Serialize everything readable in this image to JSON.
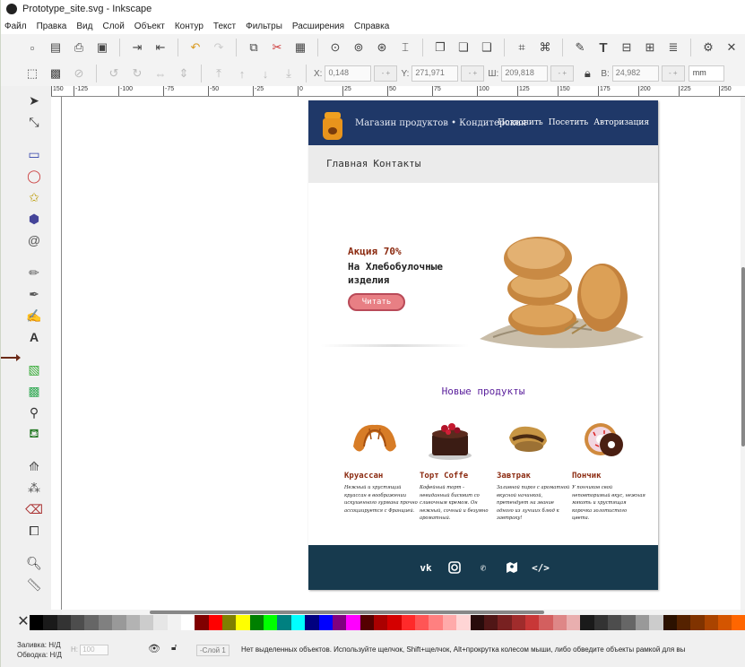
{
  "window": {
    "title": "Prototype_site.svg - Inkscape"
  },
  "menu": [
    "Файл",
    "Правка",
    "Вид",
    "Слой",
    "Объект",
    "Контур",
    "Текст",
    "Фильтры",
    "Расширения",
    "Справка"
  ],
  "toolbar_icons": [
    "new-doc-icon",
    "open-icon",
    "print-icon",
    "import-icon",
    "export-icon",
    "undo-icon",
    "redo-icon",
    "copy-icon",
    "cut-icon",
    "paste-icon",
    "zoom-selection-icon",
    "zoom-drawing-icon",
    "zoom-page-icon",
    "duplicate-icon",
    "clone-icon",
    "unlink-icon",
    "group-icon",
    "ungroup-icon",
    "fill-stroke-icon",
    "text-format-icon",
    "xml-editor-icon",
    "align-icon",
    "preferences-icon"
  ],
  "coords": {
    "x_label": "X:",
    "x_value": "0,148",
    "y_label": "Y:",
    "y_value": "271,971",
    "w_label": "Ш:",
    "w_value": "209,818",
    "h_label": "В:",
    "h_value": "24,982",
    "unit": "mm"
  },
  "ruler_ticks": [
    "150",
    "-125",
    "-100",
    "-75",
    "-50",
    "-25",
    "0",
    "25",
    "50",
    "75",
    "100",
    "125",
    "150",
    "175",
    "200",
    "225",
    "250"
  ],
  "site": {
    "shop_name": "Магазин продуктов • Кондитерская",
    "top_nav": [
      "Позвонить",
      "Посетить",
      "Авторизация"
    ],
    "sub_nav": [
      "Главная",
      "Контакты"
    ],
    "promo_title": "Акция 70%",
    "promo_line1": "На Хлебобулочные",
    "promo_line2": "изделия",
    "read_button": "Читать",
    "new_products_title": "Новые продукты",
    "products": [
      {
        "name": "Круассан",
        "desc": "Нежный и хрустящий круассан в воображении искушенного гурмана прочно ассоциируется с Францией."
      },
      {
        "name": "Торт Coffe",
        "desc": "Кофейный торт - невиданный бисквит со сливочным кремом. Он нежный, сочный и безумно ароматный."
      },
      {
        "name": "Завтрак",
        "desc": "Заливной пирог с ароматной вкусной начинкой, претендует на звание одного из лучших блюд к завтраку!"
      },
      {
        "name": "Пончик",
        "desc": "У пончиков свой неповторимый вкус, нежная мякоть и хрустящая корочка золотистого цвета."
      }
    ],
    "footer_icons": [
      "vk-icon",
      "instagram-icon",
      "phone-icon",
      "map-icon",
      "code-icon"
    ],
    "footer_labels": {
      "vk": "vk",
      "code": "</>"
    }
  },
  "status": {
    "fill_label": "Заливка: Н/Д",
    "stroke_label": "Обводка: Н/Д",
    "opacity_label": "Н:",
    "opacity_value": "100",
    "layer": "-Слой 1",
    "message": "Нет выделенных объектов. Используйте щелчок, Shift+щелчок, Alt+прокрутка колесом мыши, либо обведите объекты рамкой для вы"
  },
  "palette": [
    "#000000",
    "#1a1a1a",
    "#333333",
    "#4d4d4d",
    "#666666",
    "#808080",
    "#999999",
    "#b3b3b3",
    "#cccccc",
    "#e6e6e6",
    "#f2f2f2",
    "#ffffff",
    "#800000",
    "#ff0000",
    "#808000",
    "#ffff00",
    "#008000",
    "#00ff00",
    "#008080",
    "#00ffff",
    "#000080",
    "#0000ff",
    "#800080",
    "#ff00ff",
    "#550000",
    "#aa0000",
    "#d40000",
    "#ff2a2a",
    "#ff5555",
    "#ff8080",
    "#ffaaaa",
    "#ffd5d5",
    "#280b0b",
    "#501616",
    "#782121",
    "#a02c2c",
    "#c83737",
    "#d35f5f",
    "#de8787",
    "#e9afaf",
    "#1a1a1a",
    "#333333",
    "#4d4d4d",
    "#666666",
    "#999999",
    "#cccccc",
    "#2b1100",
    "#552200",
    "#803300",
    "#aa4400",
    "#d45500",
    "#ff6600"
  ]
}
